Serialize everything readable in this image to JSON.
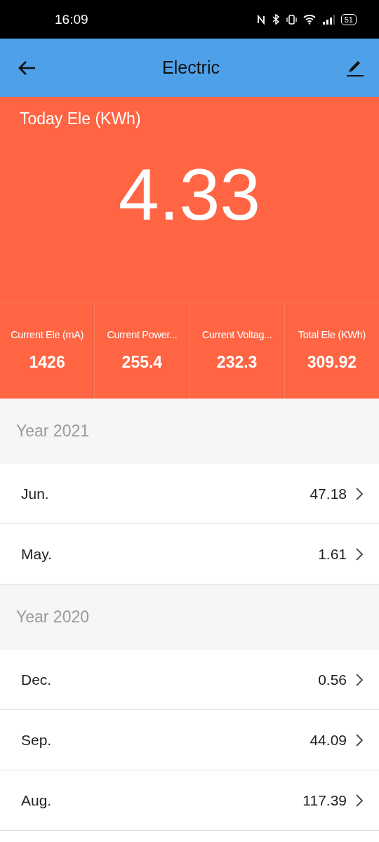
{
  "status_bar": {
    "time": "16:09",
    "battery": "51"
  },
  "app_bar": {
    "title": "Electric"
  },
  "today": {
    "label": "Today Ele (KWh)",
    "value": "4.33"
  },
  "stats": [
    {
      "label": "Current Ele (mA)",
      "value": "1426"
    },
    {
      "label": "Current Power...",
      "value": "255.4"
    },
    {
      "label": "Current Voltag...",
      "value": "232.3"
    },
    {
      "label": "Total Ele (KWh)",
      "value": "309.92"
    }
  ],
  "years": [
    {
      "title": "Year 2021",
      "months": [
        {
          "month": "Jun.",
          "value": "47.18"
        },
        {
          "month": "May.",
          "value": "1.61"
        }
      ]
    },
    {
      "title": "Year 2020",
      "months": [
        {
          "month": "Dec.",
          "value": "0.56"
        },
        {
          "month": "Sep.",
          "value": "44.09"
        },
        {
          "month": "Aug.",
          "value": "117.39"
        }
      ]
    }
  ]
}
